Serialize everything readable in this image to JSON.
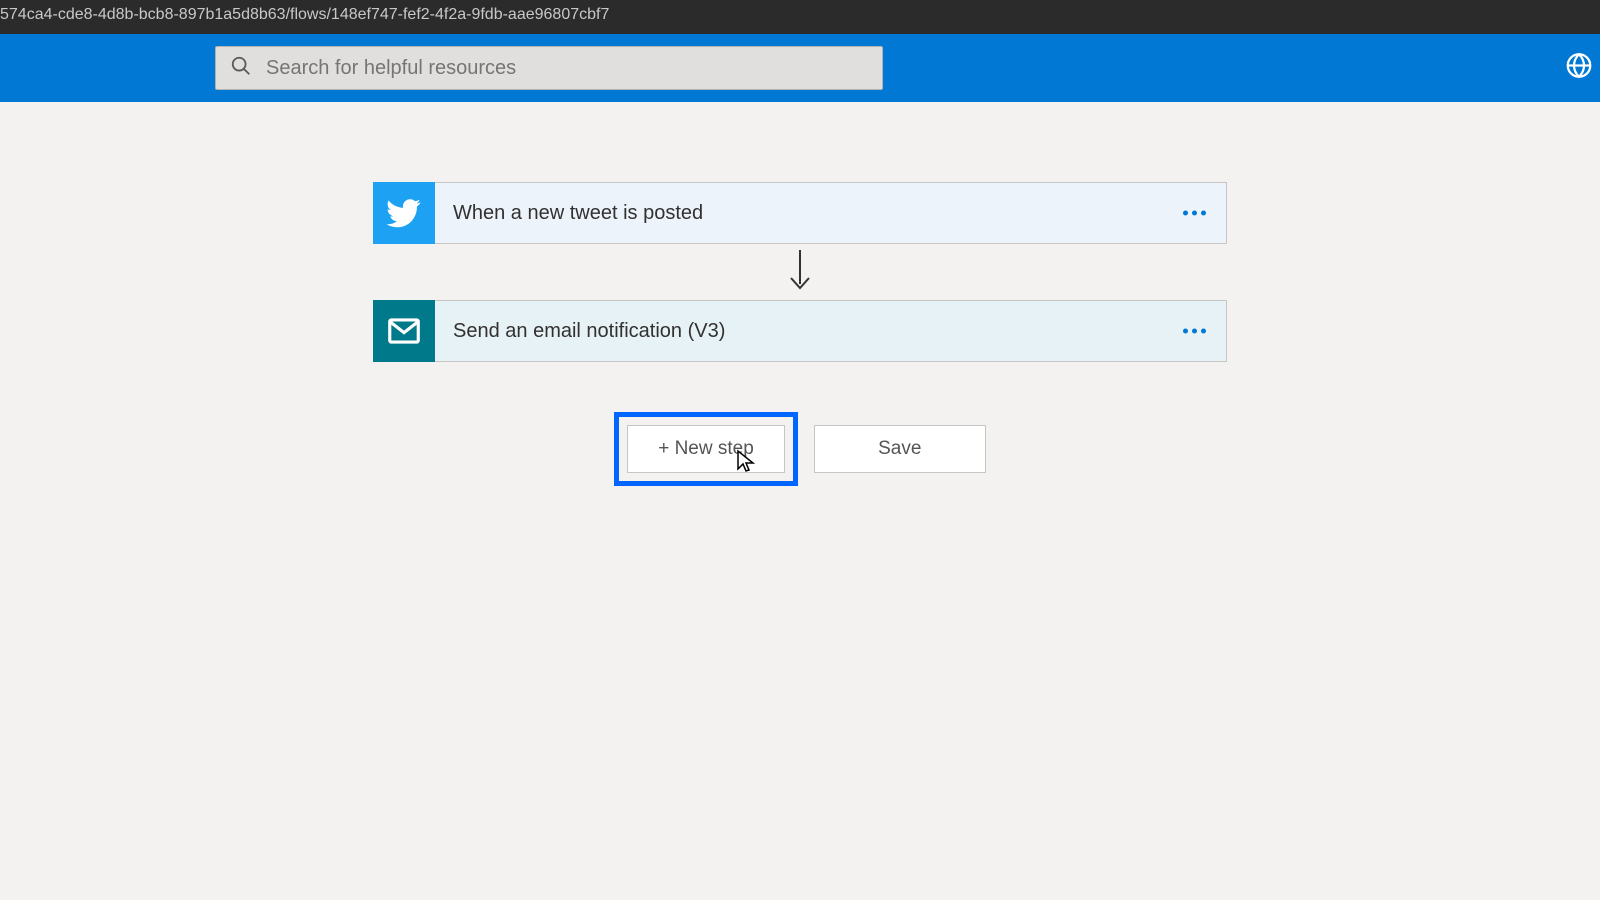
{
  "url_fragment": "574ca4-cde8-4d8b-bcb8-897b1a5d8b63/flows/148ef747-fef2-4f2a-9fdb-aae96807cbf7",
  "search": {
    "placeholder": "Search for helpful resources"
  },
  "steps": {
    "trigger": {
      "title": "When a new tweet is posted"
    },
    "action": {
      "title": "Send an email notification (V3)"
    }
  },
  "buttons": {
    "new_step": "+ New step",
    "save": "Save"
  }
}
